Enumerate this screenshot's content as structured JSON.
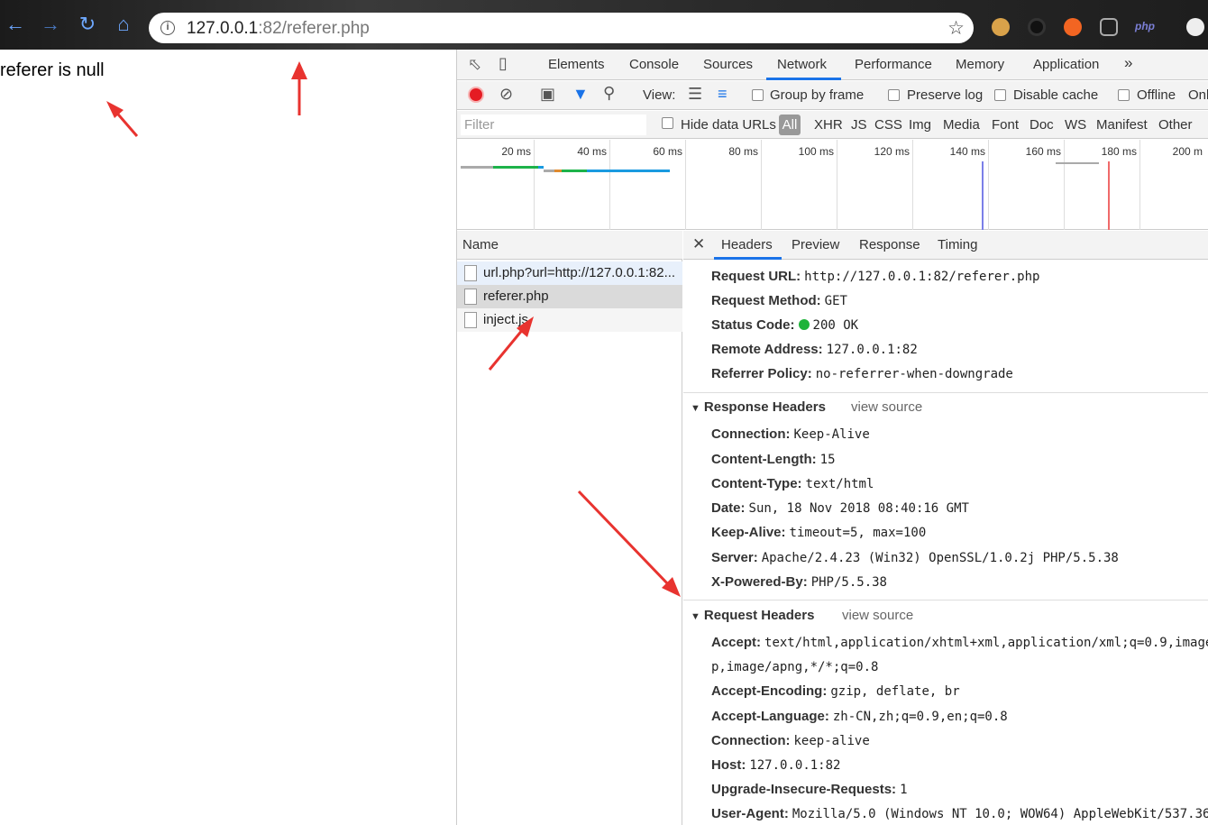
{
  "browser": {
    "url_host": "127.0.0.1",
    "url_rest": ":82/referer.php"
  },
  "page": {
    "text": "referer is null"
  },
  "devtools": {
    "tabs": [
      "Elements",
      "Console",
      "Sources",
      "Network",
      "Performance",
      "Memory",
      "Application"
    ],
    "active_tab": "Network",
    "toolbar": {
      "view_label": "View:",
      "group_by_frame": "Group by frame",
      "preserve_log": "Preserve log",
      "disable_cache": "Disable cache",
      "offline": "Offline",
      "online_partial": "Onl"
    },
    "filter": {
      "placeholder": "Filter",
      "hide_data_urls": "Hide data URLs",
      "all": "All",
      "types": [
        "XHR",
        "JS",
        "CSS",
        "Img",
        "Media",
        "Font",
        "Doc",
        "WS",
        "Manifest",
        "Other"
      ]
    },
    "timeline_ticks": [
      "20 ms",
      "40 ms",
      "60 ms",
      "80 ms",
      "100 ms",
      "120 ms",
      "140 ms",
      "160 ms",
      "180 ms",
      "200 m"
    ],
    "name_header": "Name",
    "requests": [
      "url.php?url=http://127.0.0.1:82...",
      "referer.php",
      "inject.js"
    ],
    "detail_tabs": [
      "Headers",
      "Preview",
      "Response",
      "Timing"
    ],
    "general": {
      "request_url_k": "Request URL:",
      "request_url_v": "http://127.0.0.1:82/referer.php",
      "method_k": "Request Method:",
      "method_v": "GET",
      "status_k": "Status Code:",
      "status_v": "200 OK",
      "remote_k": "Remote Address:",
      "remote_v": "127.0.0.1:82",
      "policy_k": "Referrer Policy:",
      "policy_v": "no-referrer-when-downgrade"
    },
    "response_headers": {
      "title": "Response Headers",
      "view_source": "view source",
      "items": [
        {
          "k": "Connection:",
          "v": "Keep-Alive"
        },
        {
          "k": "Content-Length:",
          "v": "15"
        },
        {
          "k": "Content-Type:",
          "v": "text/html"
        },
        {
          "k": "Date:",
          "v": "Sun, 18 Nov 2018 08:40:16 GMT"
        },
        {
          "k": "Keep-Alive:",
          "v": "timeout=5, max=100"
        },
        {
          "k": "Server:",
          "v": "Apache/2.4.23 (Win32) OpenSSL/1.0.2j PHP/5.5.38"
        },
        {
          "k": "X-Powered-By:",
          "v": "PHP/5.5.38"
        }
      ]
    },
    "request_headers": {
      "title": "Request Headers",
      "view_source": "view source",
      "accept_k": "Accept:",
      "accept_v": "text/html,application/xhtml+xml,application/xml;q=0.9,image/",
      "accept_v2": "p,image/apng,*/*;q=0.8",
      "items": [
        {
          "k": "Accept-Encoding:",
          "v": "gzip, deflate, br"
        },
        {
          "k": "Accept-Language:",
          "v": "zh-CN,zh;q=0.9,en;q=0.8"
        },
        {
          "k": "Connection:",
          "v": "keep-alive"
        },
        {
          "k": "Host:",
          "v": "127.0.0.1:82"
        },
        {
          "k": "Upgrade-Insecure-Requests:",
          "v": "1"
        },
        {
          "k": "User-Agent:",
          "v": "Mozilla/5.0 (Windows NT 10.0; WOW64) AppleWebKit/537.36"
        }
      ]
    }
  },
  "colors": {
    "accent": "#1a73e8",
    "record": "#e51c23",
    "status_ok": "#1fb33a",
    "annotation": "#e8332f"
  }
}
